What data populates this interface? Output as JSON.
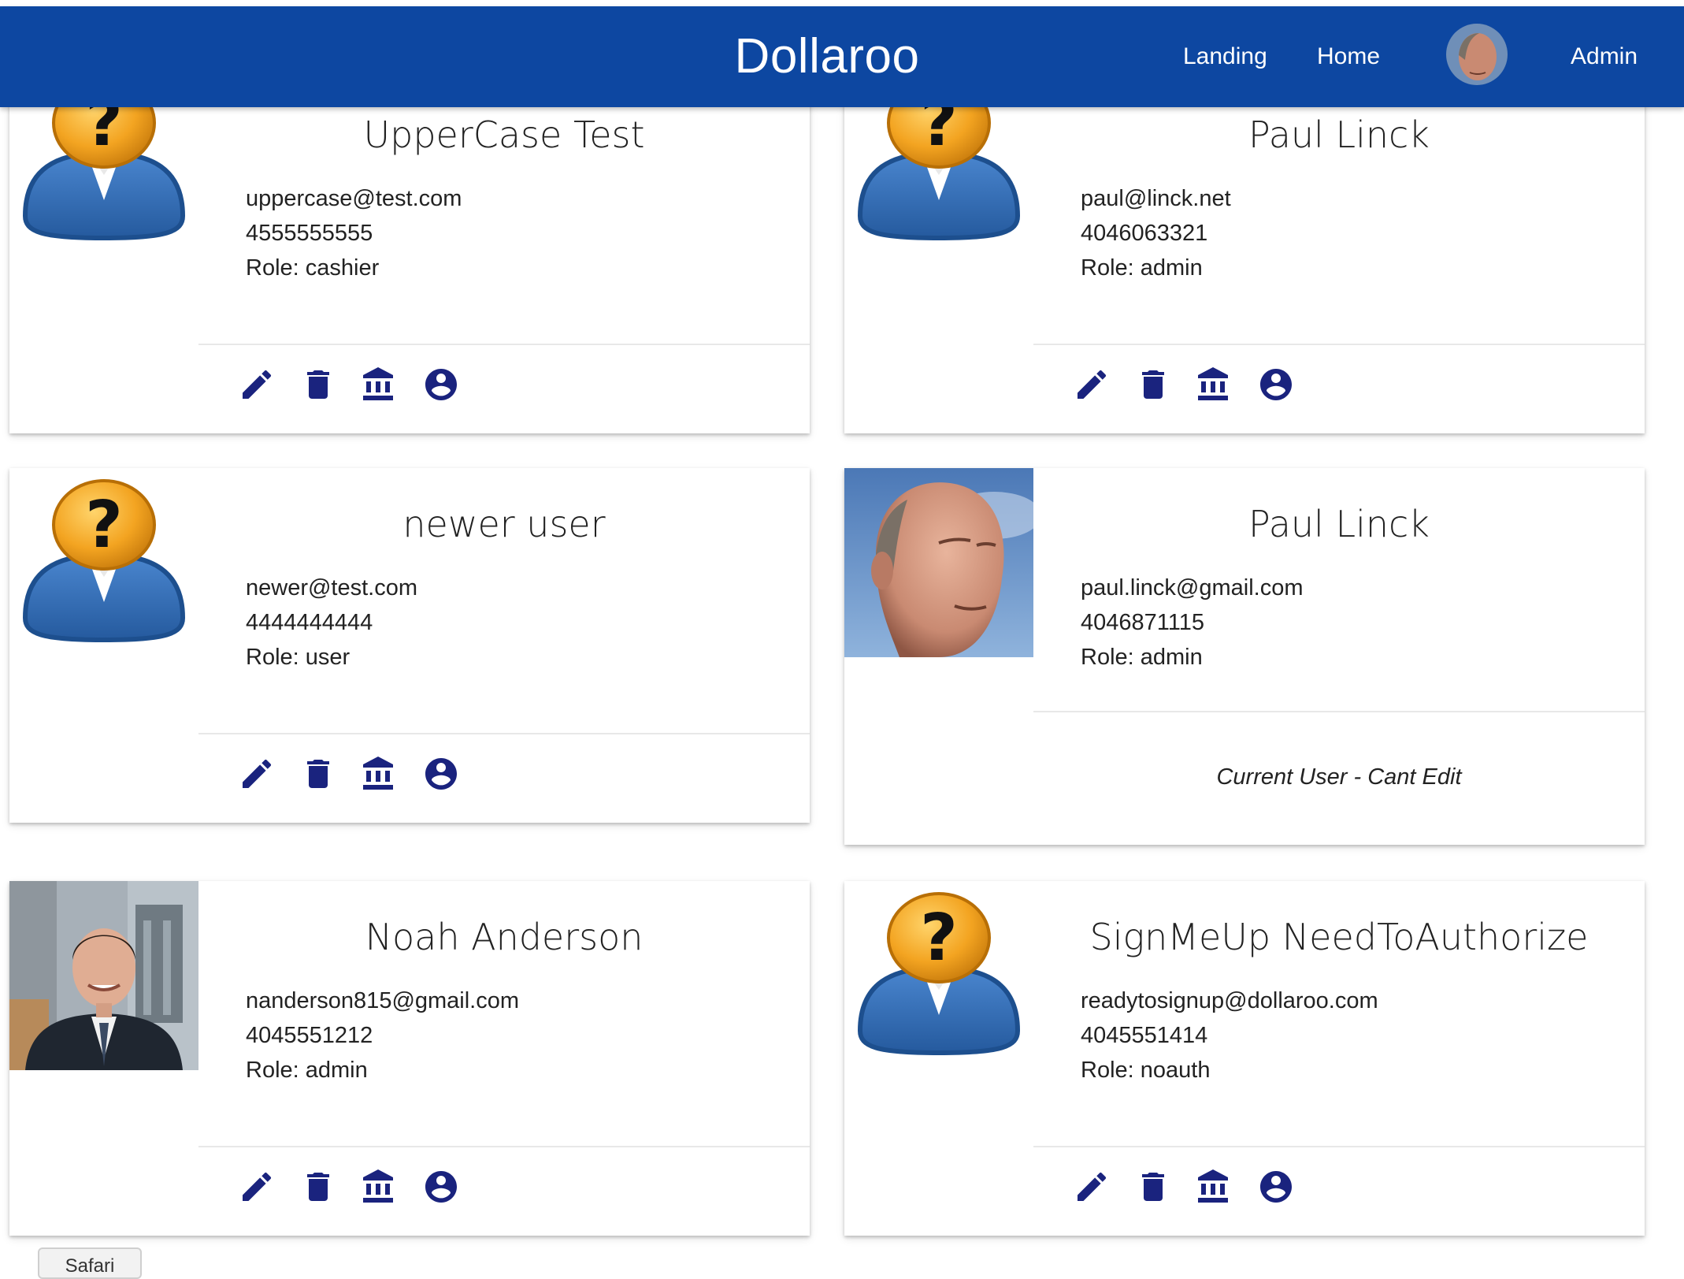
{
  "app": {
    "brand": "Dollaroo",
    "nav": {
      "landing": "Landing",
      "home": "Home",
      "admin": "Admin"
    }
  },
  "users": [
    {
      "name": "UpperCase Test",
      "email": "uppercase@test.com",
      "phone": "4555555555",
      "role": "Role: cashier",
      "avatar": "placeholder"
    },
    {
      "name": "Paul Linck",
      "email": "paul@linck.net",
      "phone": "4046063321",
      "role": "Role: admin",
      "avatar": "placeholder"
    },
    {
      "name": "newer user",
      "email": "newer@test.com",
      "phone": "4444444444",
      "role": "Role: user",
      "avatar": "placeholder"
    },
    {
      "name": "Paul Linck",
      "email": "paul.linck@gmail.com",
      "phone": "4046871115",
      "role": "Role: admin",
      "avatar": "photo",
      "note": "Current User - Cant Edit"
    },
    {
      "name": "Noah Anderson",
      "email": "nanderson815@gmail.com",
      "phone": "4045551212",
      "role": "Role: admin",
      "avatar": "photo"
    },
    {
      "name": "SignMeUp NeedToAuthorize",
      "email": "readytosignup@dollaroo.com",
      "phone": "4045551414",
      "role": "Role: noauth",
      "avatar": "placeholder"
    }
  ],
  "actions": [
    "pencil-icon",
    "trash-icon",
    "bank-icon",
    "account-circle-icon"
  ],
  "colors": {
    "navbar": "#0d47a1",
    "icon": "#1a237e",
    "placeholder_body": "#2f6db5",
    "placeholder_head": "#f0a11e"
  },
  "safari": {
    "label": "Safari"
  }
}
